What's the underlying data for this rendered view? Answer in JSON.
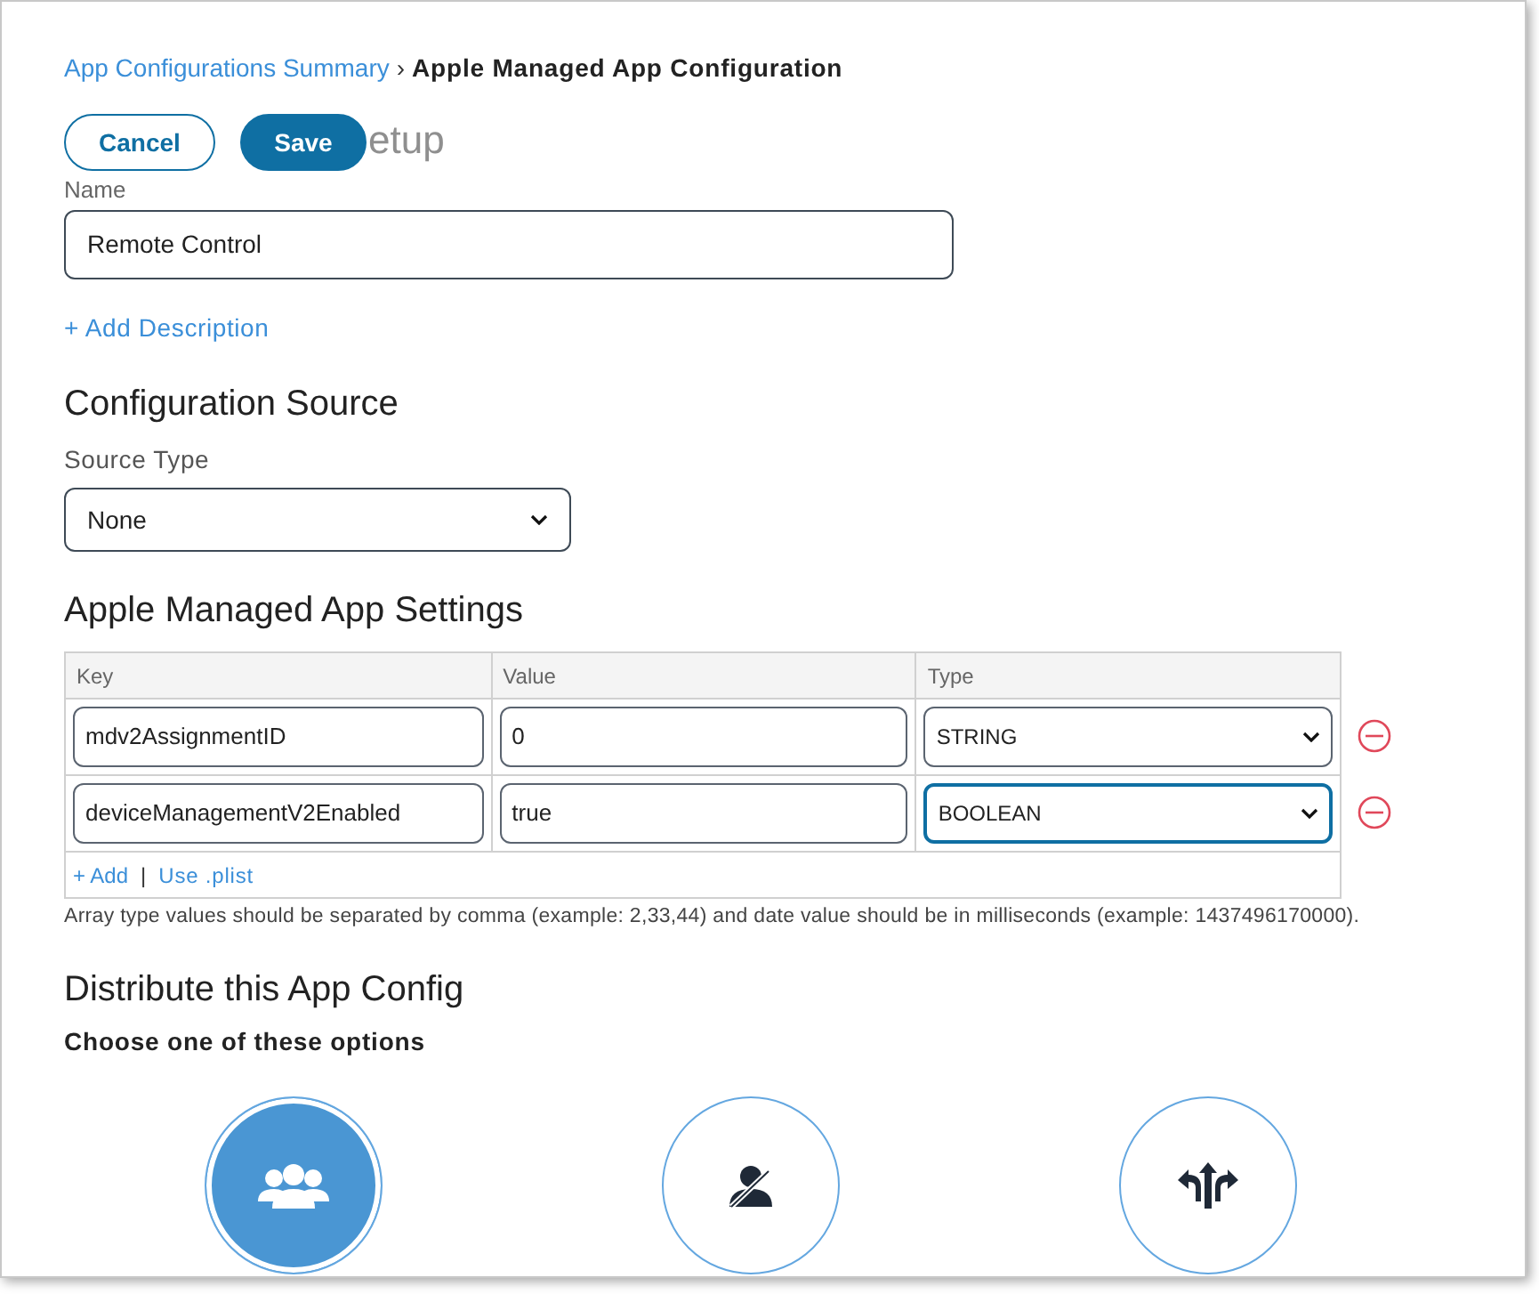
{
  "breadcrumb": {
    "link": "App Configurations Summary",
    "separator": "›",
    "current": "Apple Managed App Configuration"
  },
  "buttons": [
    {
      "label": "Cancel",
      "kind": "secondary"
    },
    {
      "label": "Save",
      "kind": "primary"
    }
  ],
  "heading": "etup",
  "name_field": {
    "label": "Name",
    "value": "Remote Control"
  },
  "add_description": "+ Add Description",
  "configuration_source": {
    "title": "Configuration Source",
    "label": "Source Type",
    "value": "None"
  },
  "settings": {
    "title": "Apple Managed App Settings",
    "columns": [
      "Key",
      "Value",
      "Type"
    ],
    "rows": [
      {
        "key": "mdv2AssignmentID",
        "value": "0",
        "type": "STRING",
        "focused": false
      },
      {
        "key": "deviceManagementV2Enabled",
        "value": "true",
        "type": "BOOLEAN",
        "focused": true
      }
    ],
    "add": "+ Add",
    "divider": "|",
    "plist": "Use .plist",
    "note": "Array type values should be separated by comma (example: 2,33,44) and date value should be in milliseconds (example: 1437496170000)."
  },
  "distribute": {
    "title": "Distribute this App Config",
    "subtitle": "Choose one of these options",
    "options": [
      {
        "kind": "group",
        "selected": true
      },
      {
        "kind": "none",
        "selected": false
      },
      {
        "kind": "split",
        "selected": false
      }
    ]
  }
}
